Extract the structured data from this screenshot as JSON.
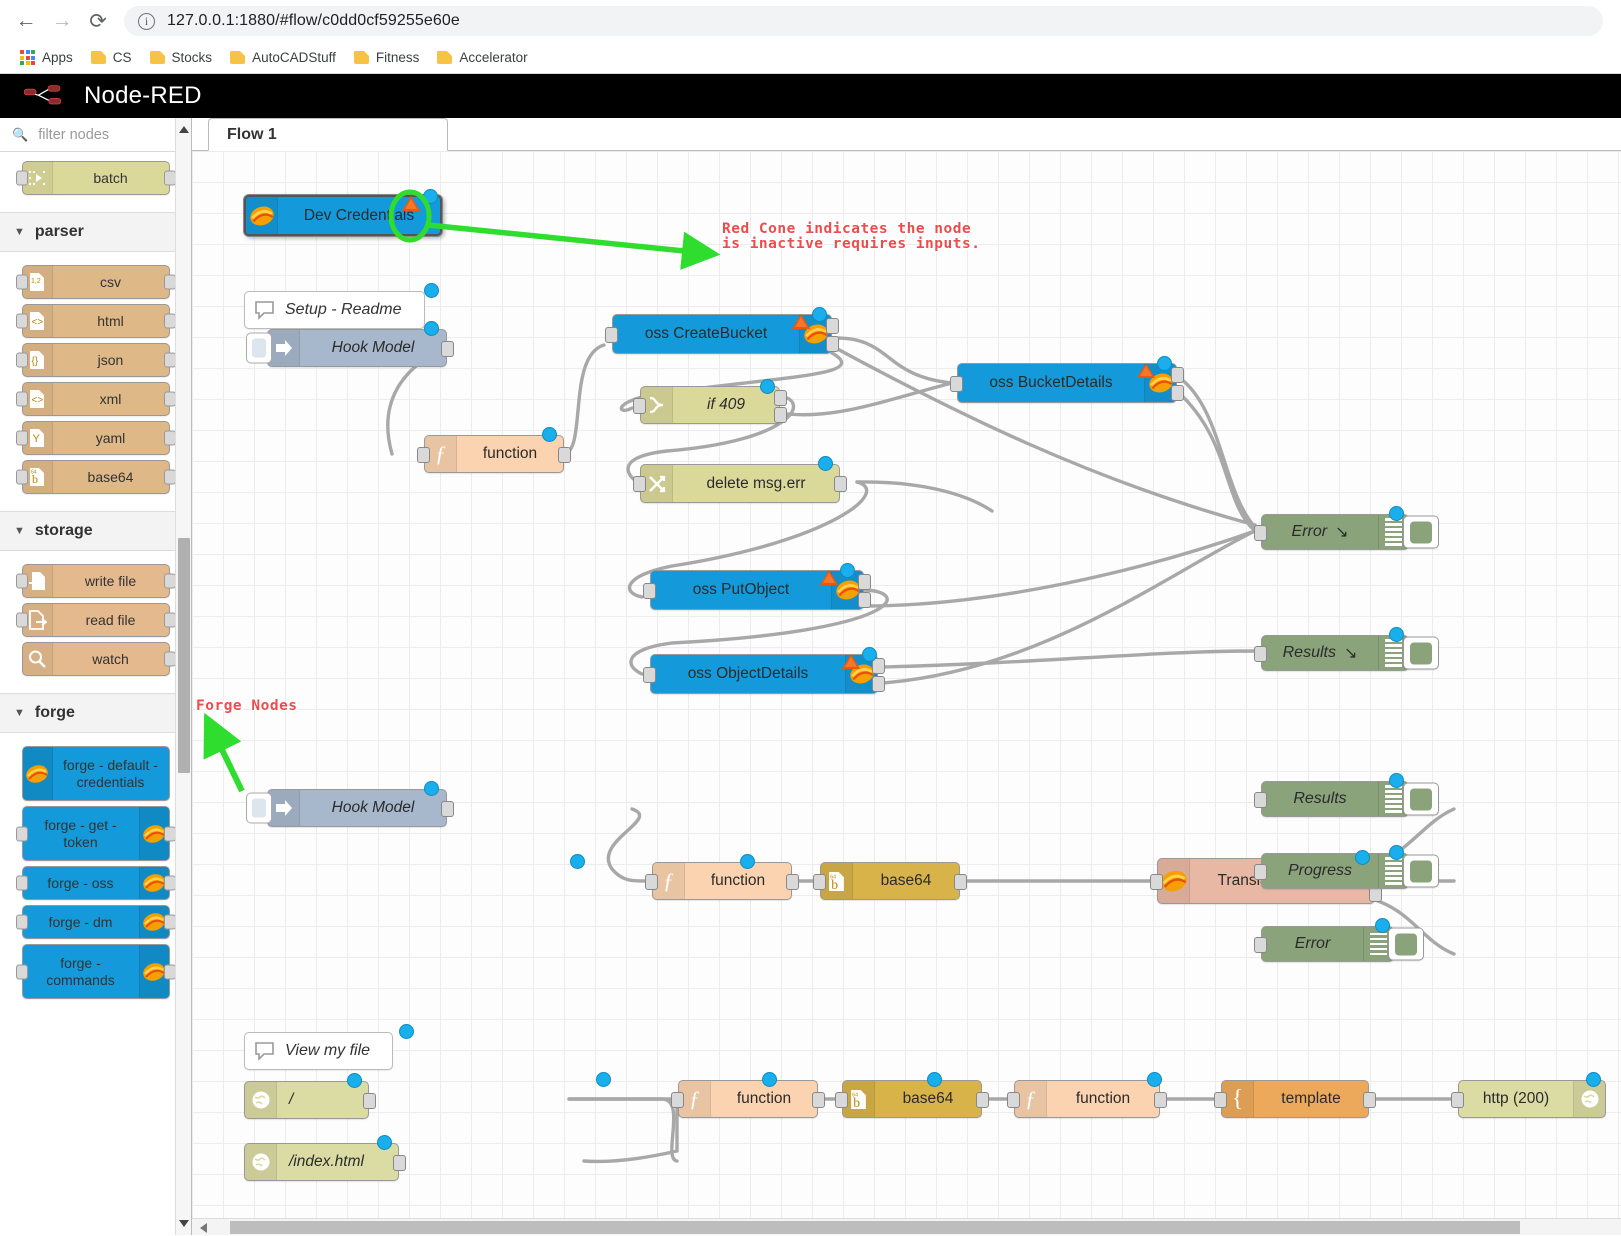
{
  "browser": {
    "back_icon": "back-arrow-icon",
    "forward_icon": "forward-arrow-icon",
    "reload_icon": "reload-icon",
    "info_glyph": "i",
    "url": "127.0.0.1:1880/#flow/c0dd0cf59255e60e",
    "bookmarks": [
      {
        "label": "Apps",
        "icon": "apps-grid-icon"
      },
      {
        "label": "CS",
        "icon": "folder-icon"
      },
      {
        "label": "Stocks",
        "icon": "folder-icon"
      },
      {
        "label": "AutoCADStuff",
        "icon": "folder-icon"
      },
      {
        "label": "Fitness",
        "icon": "folder-icon"
      },
      {
        "label": "Accelerator",
        "icon": "folder-icon"
      }
    ]
  },
  "app": {
    "title": "Node-RED",
    "logo_icon": "node-red-logo-icon",
    "header_bg": "#000000"
  },
  "palette": {
    "search_placeholder": "filter nodes",
    "search_value": "",
    "search_icon": "search-icon",
    "top_node": {
      "label": "batch",
      "icon": "batch-icon",
      "color": "#dbd99a"
    },
    "categories": [
      {
        "name": "parser",
        "chevron": "chevron-down-icon",
        "nodes": [
          {
            "label": "csv",
            "icon": "csv-icon",
            "color": "#deb887"
          },
          {
            "label": "html",
            "icon": "html-icon",
            "color": "#deb887"
          },
          {
            "label": "json",
            "icon": "json-icon",
            "color": "#deb887"
          },
          {
            "label": "xml",
            "icon": "xml-icon",
            "color": "#deb887"
          },
          {
            "label": "yaml",
            "icon": "yaml-icon",
            "color": "#deb887"
          },
          {
            "label": "base64",
            "icon": "base64-icon",
            "color": "#deb887"
          }
        ]
      },
      {
        "name": "storage",
        "chevron": "chevron-down-icon",
        "nodes": [
          {
            "label": "write file",
            "icon": "write-file-icon",
            "color": "#e3b98d"
          },
          {
            "label": "read file",
            "icon": "read-file-icon",
            "color": "#e3b98d"
          },
          {
            "label": "watch",
            "icon": "magnifier-icon",
            "color": "#e3b98d"
          }
        ]
      },
      {
        "name": "forge",
        "chevron": "chevron-down-icon",
        "nodes": [
          {
            "label": "forge - default - credentials",
            "icon": "forge-icon",
            "color": "#149ada",
            "icon_side": "left",
            "has_input": false,
            "has_output": false
          },
          {
            "label": "forge - get - token",
            "icon": "forge-icon",
            "color": "#149ada",
            "icon_side": "right",
            "has_input": true,
            "has_output": true
          },
          {
            "label": "forge - oss",
            "icon": "forge-icon",
            "color": "#149ada",
            "icon_side": "right",
            "has_input": true,
            "has_output": true
          },
          {
            "label": "forge - dm",
            "icon": "forge-icon",
            "color": "#149ada",
            "icon_side": "right",
            "has_input": true,
            "has_output": true
          },
          {
            "label": "forge - commands",
            "icon": "forge-icon",
            "color": "#149ada",
            "icon_side": "right",
            "has_input": true,
            "has_output": true
          }
        ]
      }
    ]
  },
  "workspace": {
    "tabs": [
      {
        "label": "Flow 1",
        "active": true
      }
    ],
    "annotations": [
      {
        "id": "red-cone-note",
        "lines": "Red Cone indicates the node\nis inactive requires inputs.",
        "color": "#ef4b4b"
      },
      {
        "id": "forge-nodes-note",
        "lines": "Forge Nodes",
        "color": "#ef4b4b"
      }
    ],
    "nodes": [
      {
        "id": "dev-credentials",
        "label": "Dev Credentials",
        "type": "forge",
        "color": "#149ada",
        "selected": true,
        "red_cone": true
      },
      {
        "id": "setup-readme",
        "label": "Setup - Readme",
        "type": "comment"
      },
      {
        "id": "hook-model-1",
        "label": "Hook Model",
        "type": "link-in",
        "color": "#a7b7cc"
      },
      {
        "id": "function-1",
        "label": "function",
        "type": "function",
        "color": "#fbd3b0"
      },
      {
        "id": "oss-createbucket",
        "label": "oss CreateBucket",
        "type": "forge",
        "color": "#149ada",
        "red_cone": true
      },
      {
        "id": "if-409",
        "label": "if 409",
        "type": "switch",
        "color": "#dbd99a"
      },
      {
        "id": "delete-msg-err",
        "label": "delete msg.err",
        "type": "change",
        "color": "#dbd99a"
      },
      {
        "id": "oss-bucketdetails",
        "label": "oss BucketDetails",
        "type": "forge",
        "color": "#149ada",
        "red_cone": true
      },
      {
        "id": "oss-putobject",
        "label": "oss PutObject",
        "type": "forge",
        "color": "#149ada",
        "red_cone": true
      },
      {
        "id": "oss-objectdetails",
        "label": "oss ObjectDetails",
        "type": "forge",
        "color": "#149ada",
        "red_cone": true
      },
      {
        "id": "debug-error-1",
        "label": "Error",
        "suffix": "↘",
        "type": "debug",
        "color": "#8aa37b"
      },
      {
        "id": "debug-results-1",
        "label": "Results",
        "suffix": "↘",
        "type": "debug",
        "color": "#8aa37b"
      },
      {
        "id": "hook-model-2",
        "label": "Hook Model",
        "type": "link-in",
        "color": "#a7b7cc"
      },
      {
        "id": "function-2",
        "label": "function",
        "type": "function",
        "color": "#fbd3b0"
      },
      {
        "id": "base64-1",
        "label": "base64",
        "type": "base64",
        "color": "#deb887"
      },
      {
        "id": "translate-and-wait",
        "label": "Translate and Wait",
        "type": "forge",
        "color": "#e8b8a4"
      },
      {
        "id": "debug-results-2",
        "label": "Results",
        "type": "debug",
        "color": "#8aa37b"
      },
      {
        "id": "debug-progress",
        "label": "Progress",
        "type": "debug",
        "color": "#8aa37b"
      },
      {
        "id": "debug-error-2",
        "label": "Error",
        "type": "debug",
        "color": "#8aa37b"
      },
      {
        "id": "view-my-file",
        "label": "View my file",
        "type": "comment"
      },
      {
        "id": "http-in-root",
        "label": "/",
        "type": "http-in",
        "color": "#dbdba4"
      },
      {
        "id": "http-in-index",
        "label": "/index.html",
        "type": "http-in",
        "color": "#dbdba4"
      },
      {
        "id": "function-3",
        "label": "function",
        "type": "function",
        "color": "#fbd3b0"
      },
      {
        "id": "base64-2",
        "label": "base64",
        "type": "base64",
        "color": "#d8b34a"
      },
      {
        "id": "function-4",
        "label": "function",
        "type": "function",
        "color": "#fbd3b0"
      },
      {
        "id": "template-1",
        "label": "template",
        "type": "template",
        "color": "#eda95b"
      },
      {
        "id": "http-response",
        "label": "http (200)",
        "type": "http-response",
        "color": "#dbdba4"
      }
    ]
  }
}
